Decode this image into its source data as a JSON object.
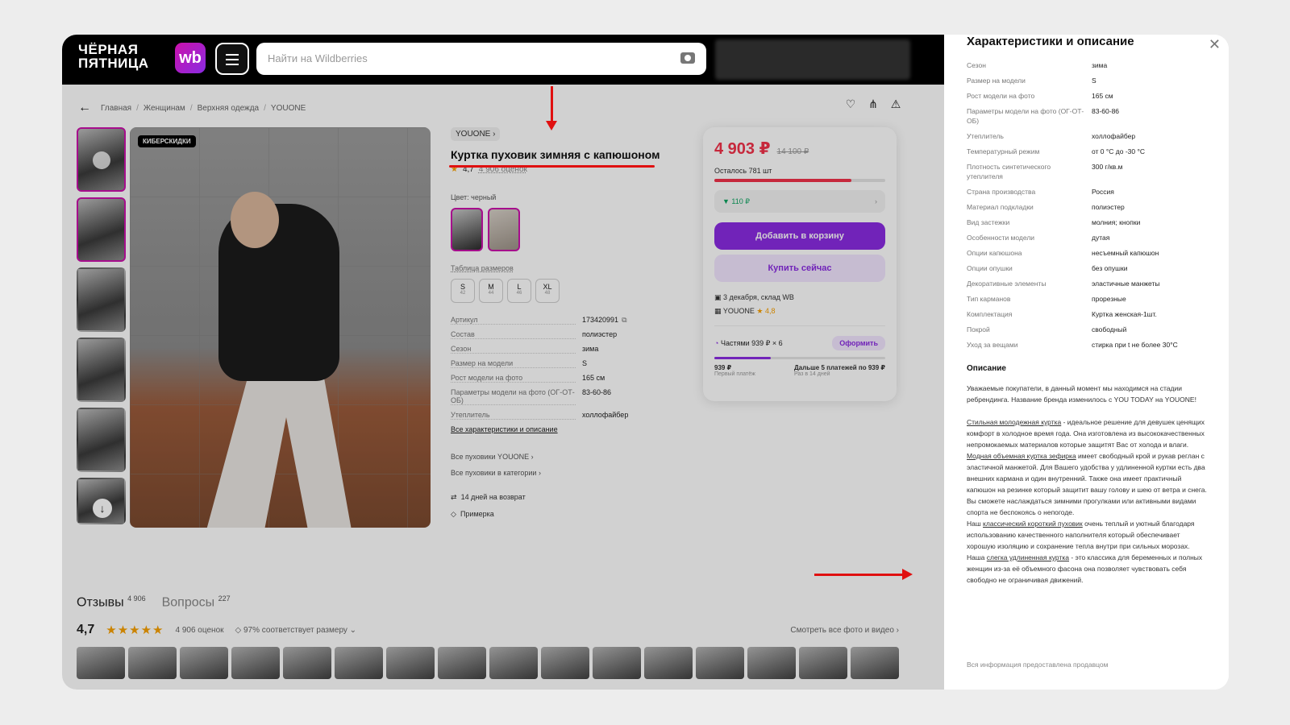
{
  "header": {
    "promo_line1": "ЧЁРНАЯ",
    "promo_line2": "ПЯТНИЦА",
    "logo": "wb",
    "search_placeholder": "Найти на Wildberries"
  },
  "breadcrumb": [
    "Главная",
    "Женщинам",
    "Верхняя одежда",
    "YOUONE"
  ],
  "gallery": {
    "badge": "КИБЕРСКИДКИ"
  },
  "product": {
    "brand": "YOUONE",
    "title": "Куртка пуховик зимняя с капюшоном",
    "rating": "4,7",
    "reviews_count": "4 906 оценок",
    "color_label": "Цвет: черный",
    "size_table_label": "Таблица размеров",
    "sizes": [
      {
        "label": "S",
        "num": "42"
      },
      {
        "label": "M",
        "num": "44"
      },
      {
        "label": "L",
        "num": "46"
      },
      {
        "label": "XL",
        "num": "48"
      }
    ],
    "specs": [
      {
        "k": "Артикул",
        "v": "173420991"
      },
      {
        "k": "Состав",
        "v": "полиэстер"
      },
      {
        "k": "Сезон",
        "v": "зима"
      },
      {
        "k": "Размер на модели",
        "v": "S"
      },
      {
        "k": "Рост модели на фото",
        "v": "165 см"
      },
      {
        "k": "Параметры модели на фото (ОГ-ОТ-ОБ)",
        "v": "83-60-86"
      },
      {
        "k": "Утеплитель",
        "v": "холлофайбер"
      }
    ],
    "all_specs_link": "Все характеристики и описание",
    "link_all_brand": "Все пуховики YOUONE",
    "link_all_category": "Все пуховики в категории",
    "return_info": "14 дней на возврат",
    "fitting_info": "Примерка"
  },
  "buybox": {
    "price": "4 903 ₽",
    "old_price": "14 100 ₽",
    "stock": "Осталось 781 шт",
    "stock_fraction": 0.8,
    "price_drop": "▼ 110 ₽",
    "add_to_cart": "Добавить в корзину",
    "buy_now": "Купить сейчас",
    "delivery": "3 декабря, склад WB",
    "seller": "YOUONE",
    "seller_rating": "★ 4,8",
    "split_label": "Частями 939 ₽ × 6",
    "split_button": "Оформить",
    "split_first_amount": "939 ₽",
    "split_first_label": "Первый платёж",
    "split_next_amount": "Дальше 5 платежей по 939 ₽",
    "split_next_label": "Раз в 14 дней"
  },
  "reviews": {
    "tab_reviews": "Отзывы",
    "tab_reviews_count": "4 906",
    "tab_questions": "Вопросы",
    "tab_questions_count": "227",
    "rating": "4,7",
    "stars": "★★★★★",
    "count": "4 906 оценок",
    "fit": "97% соответствует размеру",
    "see_all": "Смотреть все фото и видео"
  },
  "side_panel": {
    "title": "Характеристики и описание",
    "specs": [
      {
        "k": "Сезон",
        "v": "зима"
      },
      {
        "k": "Размер на модели",
        "v": "S"
      },
      {
        "k": "Рост модели на фото",
        "v": "165 см"
      },
      {
        "k": "Параметры модели на фото (ОГ-ОТ-ОБ)",
        "v": "83-60-86"
      },
      {
        "k": "Утеплитель",
        "v": "холлофайбер"
      },
      {
        "k": "Температурный режим",
        "v": "от 0 °С до -30 °С"
      },
      {
        "k": "Плотность синтетического утеплителя",
        "v": "300 г/кв.м"
      },
      {
        "k": "Страна производства",
        "v": "Россия"
      },
      {
        "k": "Материал подкладки",
        "v": "полиэстер"
      },
      {
        "k": "Вид застежки",
        "v": "молния; кнопки"
      },
      {
        "k": "Особенности модели",
        "v": "дутая"
      },
      {
        "k": "Опции капюшона",
        "v": "несъемный капюшон"
      },
      {
        "k": "Опции опушки",
        "v": "без опушки"
      },
      {
        "k": "Декоративные элементы",
        "v": "эластичные манжеты"
      },
      {
        "k": "Тип карманов",
        "v": "прорезные"
      },
      {
        "k": "Комплектация",
        "v": "Куртка женская-1шт."
      },
      {
        "k": "Покрой",
        "v": "свободный"
      },
      {
        "k": "Уход за вещами",
        "v": "стирка при t не более 30°C"
      }
    ],
    "desc_title": "Описание",
    "desc_p1": "Уважаемые покупатели, в данный момент мы находимся на стадии ребрендинга. Название бренда изменилось с YOU TODAY на YOUONE!",
    "desc_u1": "Стильная молодежная куртка",
    "desc_t1": " - идеальное решение для девушек ценящих комфорт в холодное время года. Она изготовлена из высококачественных непромокаемых материалов которые защитят Вас от холода и влаги.",
    "desc_u2": "Модная объемная куртка зефирка",
    "desc_t2": " имеет свободный крой и рукав реглан с эластичной манжетой. Для Вашего удобства у удлиненной куртки есть два внешних кармана и один внутренний. Также она имеет практичный капюшон на резинке который защитит вашу голову и шею от ветра и снега. Вы сможете наслаждаться зимними прогулками или активными видами спорта не беспокоясь о непогоде.",
    "desc_t3a": "Наш ",
    "desc_u3": "классический короткий пуховик",
    "desc_t3": " очень теплый и уютный благодаря использованию качественного наполнителя который обеспечивает хорошую изоляцию и сохранение тепла внутри при сильных морозах.",
    "desc_t4a": "Наша ",
    "desc_u4": "слегка удлиненная куртка",
    "desc_t4": " - это классика для беременных и полных женщин из-за её объемного фасона она позволяет чувствовать себя свободно не ограничивая движений.",
    "footer": "Вся информация предоставлена продавцом"
  }
}
